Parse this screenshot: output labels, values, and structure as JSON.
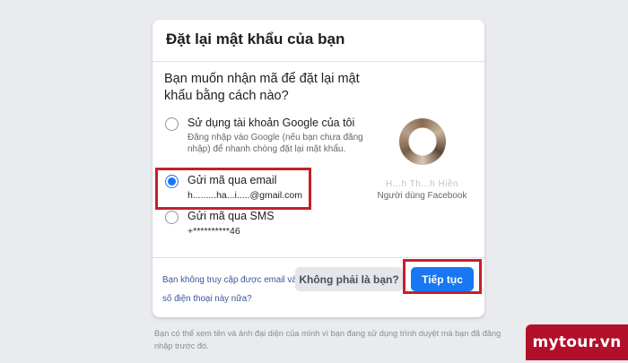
{
  "card": {
    "title": "Đặt lại mật khẩu của bạn",
    "question": "Bạn muốn nhận mã để đặt lại mật khẩu bằng cách nào?"
  },
  "options": [
    {
      "label": "Sử dụng tài khoản Google của tôi",
      "desc": "Đăng nhập vào Google (nếu bạn chưa đăng nhập) để nhanh chóng đặt lại mật khẩu.",
      "checked": false
    },
    {
      "label": "Gửi mã qua email",
      "sub": "h.........ha...i.....@gmail.com",
      "checked": true
    },
    {
      "label": "Gửi mã qua SMS",
      "sub": "+**********46",
      "checked": false
    }
  ],
  "profile": {
    "name": "H...h Th...h Hiền",
    "role": "Người dùng Facebook"
  },
  "footer": {
    "link": "Bạn không truy cập được email và số điện thoại này nữa?",
    "not_you_label": "Không phải là bạn?",
    "continue_label": "Tiếp tục"
  },
  "note": "Bạn có thể xem tên và ảnh đại diện của mình vì bạn đang sử dụng trình duyệt mà bạn đã đăng nhập trước đó.",
  "watermark": "mytour.vn",
  "colors": {
    "background": "#e9ebee",
    "accent": "#1877f2",
    "highlight": "#c51f2e",
    "watermark_bg": "#b2102a"
  }
}
